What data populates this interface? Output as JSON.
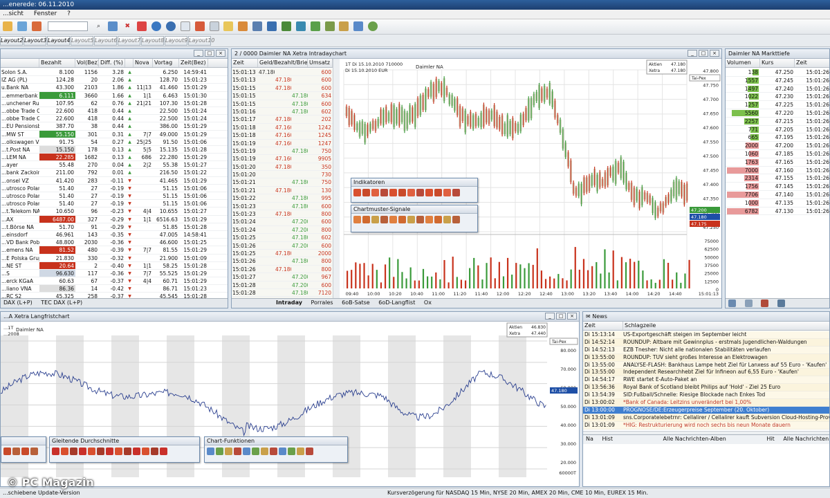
{
  "app": {
    "title": "...enerede: 06.11.2010",
    "menu": [
      "...sicht",
      "Fenster",
      "?"
    ]
  },
  "toolbar": {
    "icon_names": [
      "home-icon",
      "globe-icon",
      "pin-icon",
      "search-icon",
      "refresh-icon",
      "close-icon",
      "stop-icon",
      "info-icon",
      "help-icon",
      "page-icon",
      "alarm-icon",
      "copy-icon",
      "note-icon",
      "filter-icon",
      "wrench-icon",
      "arrow-icon",
      "line-icon",
      "channel-icon",
      "fan-icon",
      "grid-icon",
      "tag-icon",
      "chart-icon",
      "palette-icon"
    ]
  },
  "layout_tabs": [
    "Layout2",
    "Layout3",
    "Layout4",
    "Layout5",
    "Layout6",
    "Layout7",
    "Layout8",
    "Layout9",
    "Layout10"
  ],
  "watchlist": {
    "columns": [
      "",
      "Bezahlt",
      "Vol(Bez)",
      "Diff. (%)",
      "",
      "Nova",
      "Vortag",
      "Zeit(Bez)"
    ],
    "rows": [
      [
        "Solon S.A.",
        "8.100",
        "1156",
        "3.28",
        "",
        "",
        "6.250",
        "14:59:41"
      ],
      [
        "IZ AG (PL)",
        "124.28",
        "20",
        "2.06",
        "",
        "",
        "128.70",
        "15:01:23"
      ],
      [
        "u.Bank NA",
        "43.300",
        "2103",
        "1.86",
        "",
        "11|13",
        "41.460",
        "15:01:29"
      ],
      [
        "...emmerbank",
        "6.111",
        "3660",
        "1.66",
        "",
        "1|1",
        "6.463",
        "15:01:30"
      ],
      [
        "...unchener Rueck",
        "107.95",
        "62",
        "0.76",
        "",
        "21|21",
        "107.30",
        "15:01:28"
      ],
      [
        "...obbe Trade Con",
        "22.600",
        "418",
        "0.44",
        "",
        "",
        "22.500",
        "15:01:24"
      ],
      [
        "...obbe Trade Con",
        "22.600",
        "418",
        "0.44",
        "",
        "",
        "22.500",
        "15:01:24"
      ],
      [
        "...EU Pensionsb.",
        "387.70",
        "38",
        "0.44",
        "",
        "",
        "386.00",
        "15:01:29"
      ],
      [
        "...MW ST",
        "55.150",
        "301",
        "0.31",
        "",
        "7|7",
        "49.000",
        "15:01:29"
      ],
      [
        "...olkswagen VZ",
        "91.75",
        "54",
        "0.27",
        "",
        "25|25",
        "91.50",
        "15:01:06"
      ],
      [
        "...t.Post NA",
        "15.150",
        "178",
        "0.13",
        "",
        "5|5",
        "15.135",
        "15:01:28"
      ],
      [
        "...LEM NA",
        "22.285",
        "1682",
        "0.13",
        "",
        "686",
        "22.280",
        "15:01:29"
      ],
      [
        "...ayer",
        "55.48",
        "270",
        "0.04",
        "",
        "2|2",
        "55.38",
        "15:01:27"
      ],
      [
        "...bank Zackoini W",
        "211.00",
        "792",
        "0.01",
        "",
        "",
        "216.50",
        "15:01:22"
      ],
      [
        "...onsel VZ",
        "41.420",
        "283",
        "-0.11",
        "",
        "",
        "41.465",
        "15:01:29"
      ],
      [
        "...utrosco Poland S/",
        "51.40",
        "27",
        "-0.19",
        "",
        "",
        "51.15",
        "15:01:06"
      ],
      [
        "...utrosco Poland S/",
        "51.40",
        "27",
        "-0.19",
        "",
        "",
        "51.15",
        "15:01:06"
      ],
      [
        "...utrosco Poland S/",
        "51.40",
        "27",
        "-0.19",
        "",
        "",
        "51.15",
        "15:01:06"
      ],
      [
        "...t.Telekom NA",
        "10.650",
        "96",
        "-0.23",
        "",
        "4|4",
        "10.655",
        "15:01:27"
      ],
      [
        "...AX",
        "6487.00",
        "327",
        "-0.29",
        "",
        "1|1",
        "6516.63",
        "15:01:29"
      ],
      [
        "...t.Börse NA",
        "51.70",
        "91",
        "-0.29",
        "",
        "",
        "51.85",
        "15:01:28"
      ],
      [
        "...einsdorf",
        "46.961",
        "143",
        "-0.35",
        "",
        "",
        "47.005",
        "14:58:41"
      ],
      [
        "...VD Bank Pobbi",
        "48.800",
        "2030",
        "-0.36",
        "",
        "",
        "46.600",
        "15:01:25"
      ],
      [
        "...emens NA",
        "81.52",
        "480",
        "-0.39",
        "",
        "7|7",
        "81.55",
        "15:01:29"
      ],
      [
        "...E Polska Grupa",
        "21.830",
        "330",
        "-0.32",
        "",
        "",
        "21.900",
        "15:01:09"
      ],
      [
        "...NE ST",
        "20.64",
        "2",
        "-0.40",
        "",
        "1|1",
        "58.25",
        "15:01:28"
      ],
      [
        "...S",
        "96.630",
        "117",
        "-0.36",
        "",
        "7|7",
        "55.525",
        "15:01:29"
      ],
      [
        "...erck KGaA",
        "60.63",
        "67",
        "-0.37",
        "",
        "4|4",
        "60.71",
        "15:01:29"
      ],
      [
        "...liano VNA",
        "86.36",
        "14",
        "-0.42",
        "",
        "",
        "86.71",
        "15:01:23"
      ],
      [
        "...RC S2",
        "45.325",
        "258",
        "-0.37",
        "",
        "",
        "45.545",
        "15:01:28"
      ]
    ],
    "bottom_tabs": [
      "DAX (L+P)",
      "TEC DAX (L+P)"
    ]
  },
  "ticks": {
    "title": "2 / 0000 Daimler NA Xetra Intradaychart",
    "columns": [
      "Zeit",
      "Geld/Bezahlt/Brief",
      "Umsatz"
    ],
    "rows": [
      [
        "15:01:13",
        "47.180",
        "",
        "",
        "",
        "600"
      ],
      [
        "15:01:13",
        "",
        "47.180",
        "",
        "",
        "600"
      ],
      [
        "15:01:15",
        "",
        "47.180",
        "",
        "",
        "600"
      ],
      [
        "15:01:15",
        "",
        "",
        "47.180",
        "",
        "634"
      ],
      [
        "15:01:15",
        "",
        "",
        "47.180",
        "",
        "600"
      ],
      [
        "15:01:16",
        "",
        "",
        "47.180",
        "",
        "602"
      ],
      [
        "15:01:17",
        "",
        "47.180",
        "",
        "",
        "202"
      ],
      [
        "15:01:18",
        "",
        "47.160",
        "",
        "",
        "1242"
      ],
      [
        "15:01:18",
        "",
        "47.160",
        "",
        "",
        "1245"
      ],
      [
        "15:01:19",
        "",
        "47.160",
        "",
        "",
        "1247"
      ],
      [
        "15:01:19",
        "",
        "",
        "47.180",
        "",
        "750"
      ],
      [
        "15:01:19",
        "",
        "47.160",
        "",
        "",
        "9905"
      ],
      [
        "15:01:20",
        "",
        "47.180",
        "",
        "",
        "350"
      ],
      [
        "15:01:20",
        "",
        "",
        "",
        "",
        "730"
      ],
      [
        "15:01:21",
        "",
        "",
        "47.180",
        "",
        "750"
      ],
      [
        "15:01:21",
        "",
        "47.180",
        "",
        "",
        "130"
      ],
      [
        "15:01:22",
        "",
        "",
        "47.180",
        "",
        "995"
      ],
      [
        "15:01:23",
        "",
        "",
        "47.180",
        "",
        "600"
      ],
      [
        "15:01:23",
        "",
        "47.180",
        "",
        "",
        "800"
      ],
      [
        "15:01:24",
        "",
        "",
        "47.200",
        "",
        "600"
      ],
      [
        "15:01:24",
        "",
        "",
        "47.200",
        "",
        "800"
      ],
      [
        "15:01:25",
        "",
        "",
        "47.180",
        "",
        "602"
      ],
      [
        "15:01:26",
        "",
        "",
        "47.200",
        "",
        "600"
      ],
      [
        "15:01:25",
        "",
        "47.180",
        "",
        "",
        "2000"
      ],
      [
        "15:01:26",
        "",
        "",
        "47.180",
        "",
        "800"
      ],
      [
        "15:01:26",
        "",
        "47.180",
        "",
        "",
        "800"
      ],
      [
        "15:01:27",
        "",
        "",
        "47.200",
        "",
        "967"
      ],
      [
        "15:01:28",
        "",
        "",
        "47.200",
        "",
        "600"
      ],
      [
        "15:01:28",
        "",
        "",
        "47.180",
        "",
        "7120"
      ]
    ]
  },
  "intraday": {
    "symbol": "Daimler NA",
    "info_lines": [
      "1T   Di 15.10.2010  710000",
      "     Di 15.10.2010  EUR"
    ],
    "price_box": [
      [
        "Aktien",
        "47.180"
      ],
      [
        "Xetra",
        "47.180"
      ]
    ],
    "right_label": "Tai-Pex",
    "price_ticks": [
      "47.800",
      "47.750",
      "47.700",
      "47.650",
      "47.600",
      "47.550",
      "47.500",
      "47.450",
      "47.400",
      "47.350",
      "47.300",
      "47.250"
    ],
    "price_tags": [
      {
        "text": "47.200",
        "color": "#3a9a3a"
      },
      {
        "text": "47.180",
        "color": "#1e4fa6"
      },
      {
        "text": "47.175",
        "color": "#c8321c"
      }
    ],
    "vol_ticks": [
      "75000",
      "62500",
      "50000",
      "37500",
      "25000",
      "12500",
      "0"
    ],
    "time_ticks": [
      "09:40",
      "10:00",
      "10:20",
      "10:40",
      "11:00",
      "11:20",
      "11:40",
      "12:00",
      "12:20",
      "12:40",
      "13:00",
      "13:20",
      "13:40",
      "14:00",
      "14:20",
      "14:40"
    ],
    "last_time": "15:01:13",
    "bottom_tabs": [
      "Intraday",
      "Porrales",
      "6oB-Satse",
      "6oD-Langflist",
      "Ox"
    ],
    "float_indikatoren": "Indikatoren",
    "float_chartmuster": "Chartmuster-Signale"
  },
  "markttiefe": {
    "title": "Daimler NA Markttiefe",
    "columns": [
      "Volumen",
      "Kurs",
      "Zeit"
    ],
    "rows": [
      [
        "138",
        "47.250",
        "15:01:26"
      ],
      [
        "1557",
        "47.245",
        "15:01:26"
      ],
      [
        "1497",
        "47.240",
        "15:01:26"
      ],
      [
        "1022",
        "47.230",
        "15:01:26"
      ],
      [
        "1257",
        "47.225",
        "15:01:26"
      ],
      [
        "5560",
        "47.220",
        "15:01:26"
      ],
      [
        "2257",
        "47.215",
        "15:01:26"
      ],
      [
        "771",
        "47.205",
        "15:01:26"
      ],
      [
        "665",
        "47.195",
        "15:01:26"
      ],
      [
        "2000",
        "47.200",
        "15:01:26"
      ],
      [
        "1060",
        "47.185",
        "15:01:26"
      ],
      [
        "1763",
        "47.165",
        "15:01:26"
      ],
      [
        "7000",
        "47.160",
        "15:01:26"
      ],
      [
        "2314",
        "47.155",
        "15:01:26"
      ],
      [
        "1756",
        "47.145",
        "15:01:26"
      ],
      [
        "7706",
        "47.140",
        "15:01:26"
      ],
      [
        "1000",
        "47.135",
        "15:01:26"
      ],
      [
        "6782",
        "47.130",
        "15:01:26"
      ]
    ]
  },
  "longterm": {
    "title": "...A Xetra Langfristchart",
    "symbol": "Daimler NA",
    "info_lines": [
      "...1T",
      "...2008"
    ],
    "price_box": [
      [
        "Aktien",
        "46.830"
      ],
      [
        "Xetra",
        "47.440"
      ]
    ],
    "right_label": "Tai-Pex",
    "price_ticks": [
      "80.000",
      "70.000",
      "60.000",
      "50.000",
      "40.000",
      "30.000",
      "20.000"
    ],
    "price_tag": "47.180",
    "vol_tick": "60000T",
    "float_durchschnitte": "Gleitende Durchschnitte",
    "float_chartfunktionen": "Chart-Funktionen"
  },
  "news": {
    "title": "News",
    "columns": [
      "Zeit",
      "Schlagzeile"
    ],
    "rows": [
      [
        "Di 15:13:14",
        "US-Exportgeschäft steigen im September leicht",
        ""
      ],
      [
        "Di 14:52:14",
        "ROUNDUP: Altbare mit Gewinnplus - erstmals Jugendlichen-Waldungen",
        ""
      ],
      [
        "Di 14:52:13",
        "EZB Tnesher: Nicht alle nationalen Stabilitäten verlaufen",
        ""
      ],
      [
        "Di 13:55:00",
        "ROUNDUP: TUV sieht großes Interesse an Elektrowagen",
        ""
      ],
      [
        "Di 13:55:00",
        "ANALYSE-FLASH: Bankhaus Lampe hebt Ziel für Lanxess auf 55 Euro - 'Kaufen'",
        ""
      ],
      [
        "Di 13:55:00",
        "Independent Researchhebt Ziel für Infineon auf 6,55 Euro - 'Kaufen'",
        ""
      ],
      [
        "Di 14:54:17",
        "RWE startet E-Auto-Paket an",
        ""
      ],
      [
        "Di 13:56:36",
        "Royal Bank of Scotland bleibt Philips auf 'Hold' - Ziel 25 Euro",
        ""
      ],
      [
        "Di 13:54:39",
        "SID:Fußball/Schnelle: Riesige Blockade nach Enkes Tod",
        ""
      ],
      [
        "Di 13:00:02",
        "*Bank of Canada: Leitzins unverändert bei 1,00%",
        ""
      ],
      [
        "Di 13:00:00",
        "PROGNOSE/DE:Erzeugerpreise September (20. Oktober)",
        "selected"
      ],
      [
        "Di 13:01:09",
        "sns.Corporatelebetrnr: Cellalirer / Cellalirer kauft Subversion Cloud-Hosting-Provider",
        ""
      ],
      [
        "Di 13:01:09",
        "*HIG: Restrukturierung wird noch sechs bis neun Monate dauern",
        ""
      ]
    ],
    "bottom_bar": [
      "Na",
      "Hist",
      "Alle Nachrichten-Alben",
      "Hit",
      "Alle Nachrichten"
    ]
  },
  "statusbar": {
    "left": "...schiebene   Update-Version",
    "right": "Kursverzögerung für NASDAQ 15 Min, NYSE 20 Min, AMEX 20 Min, CME 10 Min, EUREX 15 Min."
  },
  "watermark": "© PC Magazin",
  "colors": {
    "up": "#3a9a3a",
    "down": "#c8321c",
    "accent": "#1e4fa6",
    "candle_body": "#c9c9b0"
  }
}
